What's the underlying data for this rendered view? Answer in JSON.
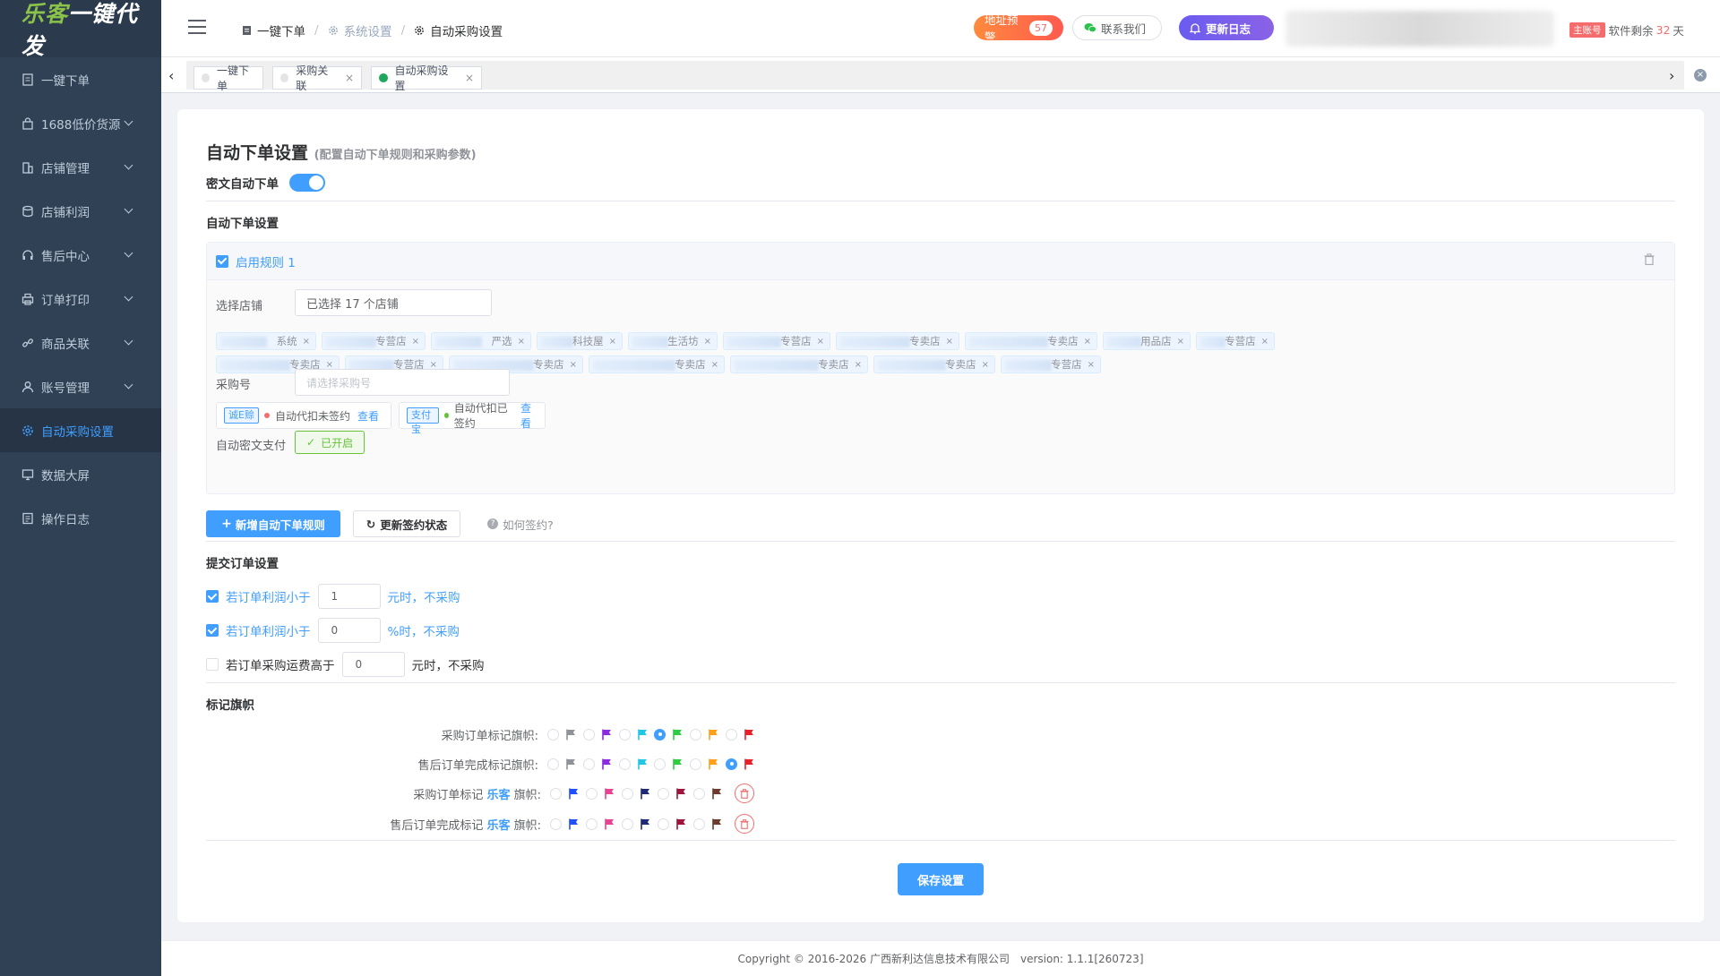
{
  "app": {
    "logo_a": "乐客",
    "logo_b": "一键代发"
  },
  "sidebar": {
    "items": [
      {
        "label": "一键下单",
        "icon": "document-icon",
        "has_arrow": false
      },
      {
        "label": "1688低价货源",
        "icon": "bag-icon",
        "has_arrow": true
      },
      {
        "label": "店铺管理",
        "icon": "building-icon",
        "has_arrow": true
      },
      {
        "label": "店铺利润",
        "icon": "database-icon",
        "has_arrow": true
      },
      {
        "label": "售后中心",
        "icon": "headset-icon",
        "has_arrow": true
      },
      {
        "label": "订单打印",
        "icon": "printer-icon",
        "has_arrow": true
      },
      {
        "label": "商品关联",
        "icon": "link-icon",
        "has_arrow": true
      },
      {
        "label": "账号管理",
        "icon": "user-icon",
        "has_arrow": true
      },
      {
        "label": "自动采购设置",
        "icon": "gear-icon",
        "has_arrow": false,
        "active": true
      },
      {
        "label": "数据大屏",
        "icon": "screen-icon",
        "has_arrow": false
      },
      {
        "label": "操作日志",
        "icon": "log-icon",
        "has_arrow": false
      }
    ]
  },
  "header": {
    "breadcrumb": [
      "一键下单",
      "系统设置",
      "自动采购设置"
    ],
    "address_btn": "地址预警",
    "address_count": "57",
    "contact_btn": "联系我们",
    "update_btn": "更新日志",
    "account_tag": "主账号",
    "remaining_prefix": "软件剩余",
    "remaining_days": "32",
    "remaining_suffix": "天"
  },
  "tabs": [
    {
      "label": "一键下单",
      "closable": false,
      "active": false
    },
    {
      "label": "采购关联",
      "closable": true,
      "active": false
    },
    {
      "label": "自动采购设置",
      "closable": true,
      "active": true
    }
  ],
  "page": {
    "title": "自动下单设置",
    "subtitle": "(配置自动下单规则和采购参数)",
    "secret_auto_label": "密文自动下单",
    "secret_auto_on": true,
    "section_auto": "自动下单设置",
    "rule": {
      "label": "启用规则 1",
      "enabled": true,
      "shop_label": "选择店铺",
      "shop_value": "已选择 17 个店铺",
      "shops_row1": [
        "系统",
        "专营店",
        "严选",
        "科技屋",
        "生活坊",
        "专营店",
        "专卖店",
        "专卖店",
        "用品店",
        "专营店"
      ],
      "shops_row2": [
        "专卖店",
        "专营店",
        "专卖店",
        "专卖店",
        "专卖店",
        "专卖店",
        "专营店"
      ],
      "purchase_label": "采购号",
      "purchase_placeholder": "请选择采购号",
      "sign1_tag": "诚E赊",
      "sign1_text": "自动代扣未签约",
      "sign1_link": "查看",
      "sign2_tag": "支付宝",
      "sign2_text": "自动代扣已签约",
      "sign2_link": "查看",
      "secret_pay_label": "自动密文支付",
      "secret_pay_value": "已开启"
    },
    "btn_add_rule": "新增自动下单规则",
    "btn_refresh": "更新签约状态",
    "btn_howto": "如何签约?",
    "section_submit": "提交订单设置",
    "conditions": [
      {
        "checked": true,
        "prefix": "若订单利润小于",
        "value": "1",
        "suffix": "元时，不采购"
      },
      {
        "checked": true,
        "prefix": "若订单利润小于",
        "value": "0",
        "suffix": "%时，不采购"
      },
      {
        "checked": false,
        "prefix": "若订单采购运费高于",
        "value": "0",
        "suffix": "元时，不采购"
      }
    ],
    "section_flags": "标记旗帜",
    "flag_rows": [
      {
        "label_a": "采购订单标记旗帜:",
        "label_hl": "",
        "label_b": "",
        "selected": 3,
        "colors": [
          "#909399",
          "#8a2be2",
          "#22c7e6",
          "#2ecc40",
          "#ff9f1a",
          "#e8202a"
        ],
        "delete": false
      },
      {
        "label_a": "售后订单完成标记旗帜:",
        "label_hl": "",
        "label_b": "",
        "selected": 5,
        "colors": [
          "#909399",
          "#8a2be2",
          "#22c7e6",
          "#2ecc40",
          "#ff9f1a",
          "#e8202a"
        ],
        "delete": false
      },
      {
        "label_a": "采购订单标记 ",
        "label_hl": "乐客",
        "label_b": " 旗帜:",
        "selected": -1,
        "colors": [
          "#1f4fff",
          "#e84393",
          "#1e2a78",
          "#a0143c",
          "#6d3b2e"
        ],
        "delete": true
      },
      {
        "label_a": "售后订单完成标记 ",
        "label_hl": "乐客",
        "label_b": " 旗帜:",
        "selected": -1,
        "colors": [
          "#1f4fff",
          "#e84393",
          "#1e2a78",
          "#a0143c",
          "#6d3b2e"
        ],
        "delete": true
      }
    ],
    "save_btn": "保存设置"
  },
  "footer": {
    "copyright": "Copyright © 2016-2026 广西新利达信息技术有限公司",
    "version": "version: 1.1.1[260723]"
  }
}
